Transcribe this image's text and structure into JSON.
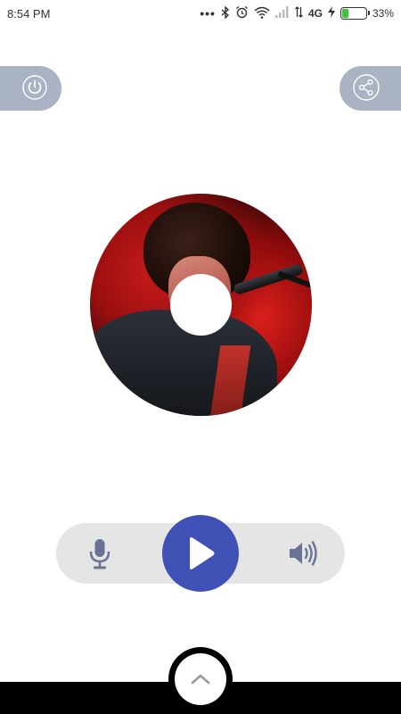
{
  "status_bar": {
    "time": "8:54 PM",
    "network": "4G",
    "battery_percent": "33%",
    "battery_level": 0.33,
    "icons": [
      "more-dots-icon",
      "bluetooth-icon",
      "alarm-icon",
      "wifi-icon",
      "signal-icon",
      "data-arrows-icon",
      "charging-icon",
      "battery-icon"
    ]
  },
  "top_actions": {
    "left_icon": "power-icon",
    "right_icon": "share-icon"
  },
  "album_art": {
    "description_icon": "album-disc",
    "colors": {
      "accent_red": "#c81a1a",
      "dark": "#120304"
    }
  },
  "player_controls": {
    "left_icon": "microphone-icon",
    "center_icon": "play-icon",
    "right_icon": "volume-icon",
    "play_button_color": "#3f51b5",
    "pill_color": "#e5e5e5",
    "icon_color": "#6b7393"
  },
  "bottom": {
    "expand_icon": "chevron-up-icon"
  },
  "colors": {
    "side_button": "#a9b3c3",
    "background": "#ffffff"
  }
}
